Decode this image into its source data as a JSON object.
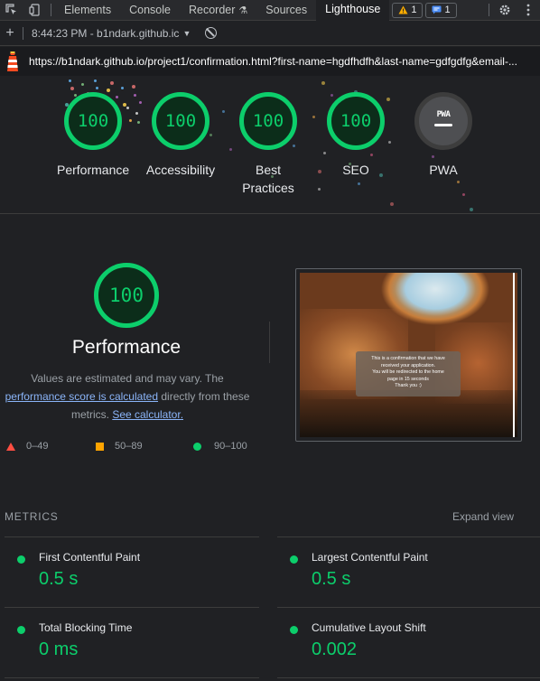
{
  "devtools": {
    "tabs": [
      "Elements",
      "Console",
      "Recorder",
      "Sources",
      "Lighthouse"
    ],
    "active_tab": "Lighthouse",
    "warning_count": "1",
    "message_count": "1"
  },
  "toolbar": {
    "run_label": "8:44:23 PM - b1ndark.github.ic"
  },
  "url": "https://b1ndark.github.io/project1/confirmation.html?first-name=hgdfhdfh&last-name=gdfgdfg&email-...",
  "categories": [
    {
      "score": "100",
      "label": "Performance",
      "color": "#0cce6b"
    },
    {
      "score": "100",
      "label": "Accessibility",
      "color": "#0cce6b"
    },
    {
      "score": "100",
      "label": "Best Practices",
      "color": "#0cce6b"
    },
    {
      "score": "100",
      "label": "SEO",
      "color": "#0cce6b"
    },
    {
      "score": "PWA",
      "label": "PWA",
      "color": "#4e4f52"
    }
  ],
  "performance": {
    "score": "100",
    "title": "Performance",
    "desc_1": "Values are estimated and may vary. The",
    "desc_link": "performance score is calculated",
    "desc_2": "directly from these",
    "desc_3": "metrics.",
    "desc_link2": "See calculator."
  },
  "legend": {
    "fail": "0–49",
    "average": "50–89",
    "pass": "90–100"
  },
  "screenshot_text": {
    "line1": "This is a confirmation that we have",
    "line2": "received your application.",
    "line3": "You will be redirected to the home",
    "line4": "page in 15 seconds",
    "line5": "Thank you :)"
  },
  "metrics": {
    "header": "METRICS",
    "expand": "Expand view",
    "items": [
      {
        "title": "First Contentful Paint",
        "value": "0.5 s"
      },
      {
        "title": "Largest Contentful Paint",
        "value": "0.5 s"
      },
      {
        "title": "Total Blocking Time",
        "value": "0 ms"
      },
      {
        "title": "Cumulative Layout Shift",
        "value": "0.002"
      }
    ]
  },
  "colors": {
    "pass": "#0cce6b",
    "average": "#ffa400",
    "fail": "#ff4e42",
    "link": "#8ab4f8"
  }
}
